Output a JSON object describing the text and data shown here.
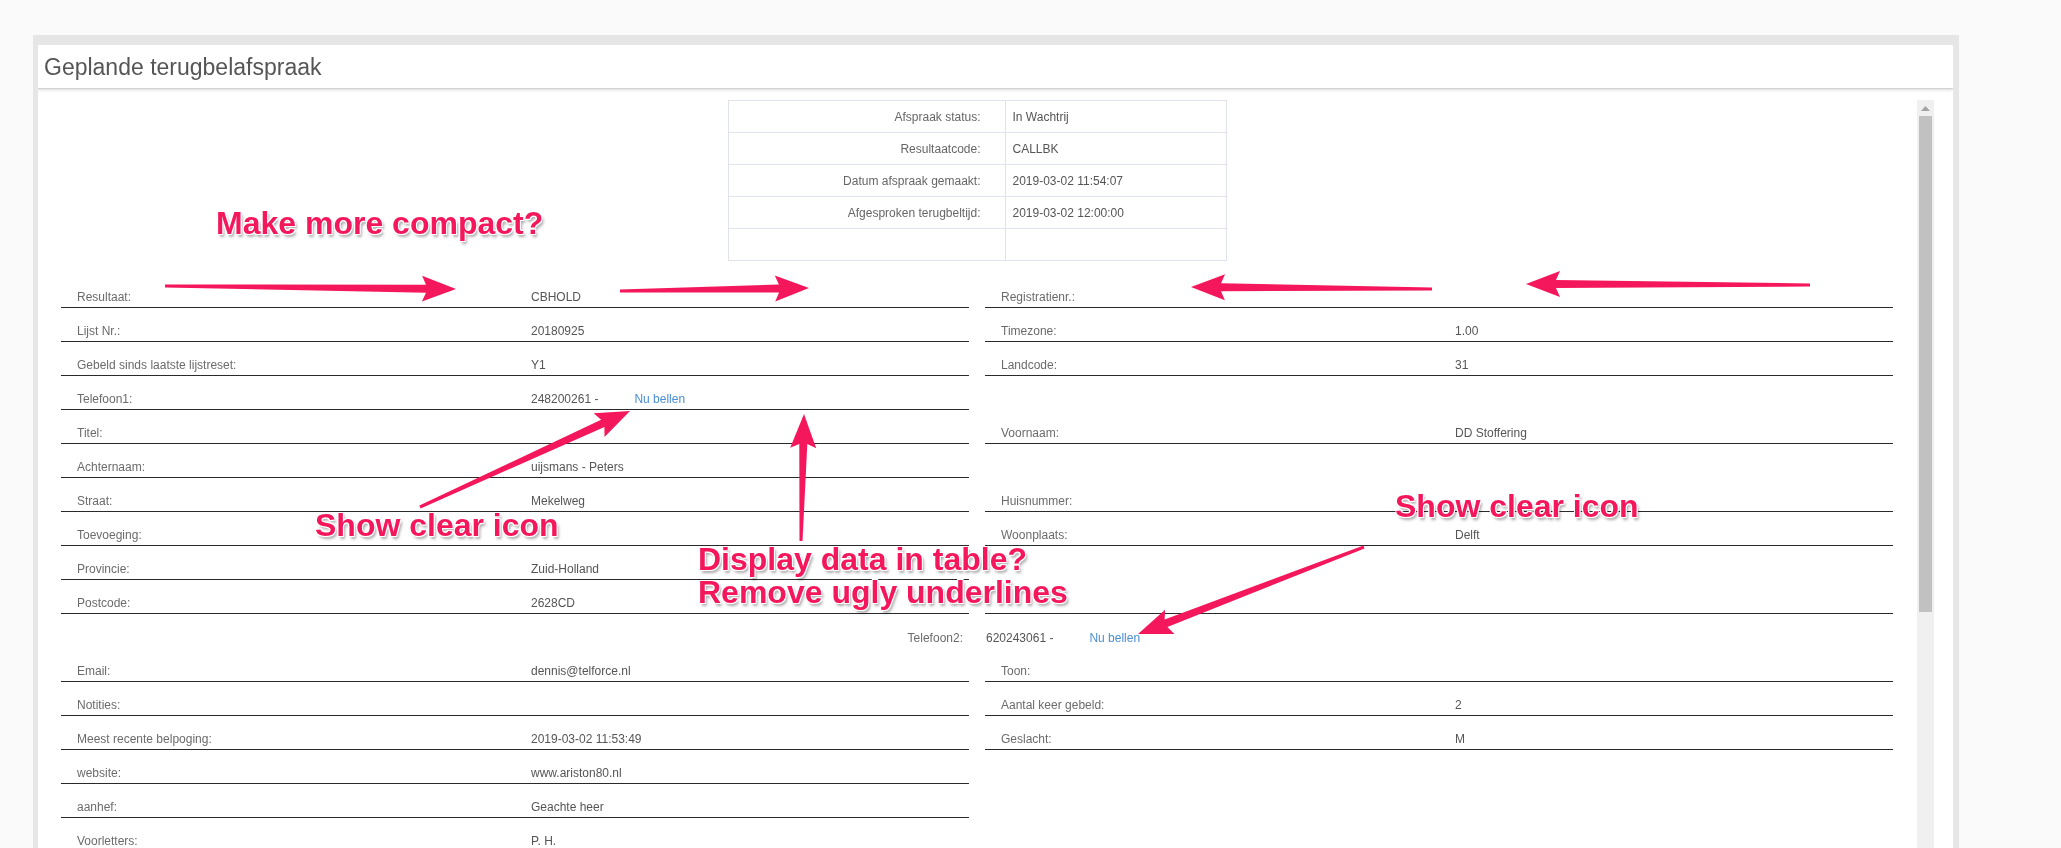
{
  "window": {
    "title": "Geplande terugbelafspraak"
  },
  "status_table": {
    "rows": [
      {
        "kind": "entry",
        "label": "Afspraak status:",
        "value": "In Wachtrij"
      },
      {
        "kind": "entry",
        "label": "Resultaatcode:",
        "value": "CALLBK"
      },
      {
        "kind": "entry",
        "label": "Datum afspraak gemaakt:",
        "value": "2019-03-02 11:54:07"
      },
      {
        "kind": "entry",
        "label": "Afgesproken terugbeltijd:",
        "value": "2019-03-02 12:00:00"
      },
      {
        "kind": "empty"
      }
    ]
  },
  "fields_top": {
    "left": [
      {
        "kind": "field",
        "label": "Resultaat:",
        "value": "CBHOLD"
      },
      {
        "kind": "field",
        "label": "Lijst Nr.:",
        "value": "20180925"
      },
      {
        "kind": "field",
        "label": "Gebeld sinds laatste lijstreset:",
        "value": "Y1"
      },
      {
        "kind": "field",
        "label": "Telefoon1:",
        "value": "248200261 -",
        "link": "Nu bellen"
      },
      {
        "kind": "field",
        "label": "Titel:"
      },
      {
        "kind": "field",
        "label": "Achternaam:",
        "value": "uijsmans - Peters"
      },
      {
        "kind": "field",
        "label": "Straat:",
        "value": "Mekelweg"
      },
      {
        "kind": "field",
        "label": "Toevoeging:"
      },
      {
        "kind": "field",
        "label": "Provincie:",
        "value": "Zuid-Holland"
      },
      {
        "kind": "field",
        "label": "Postcode:",
        "value": "2628CD"
      }
    ],
    "right": [
      {
        "kind": "field",
        "label": "Registratienr.:"
      },
      {
        "kind": "field",
        "label": "Timezone:",
        "value": "1.00"
      },
      {
        "kind": "field",
        "label": "Landcode:",
        "value": "31"
      },
      {
        "kind": "blank"
      },
      {
        "kind": "field",
        "label": "Voornaam:",
        "value": "DD Stoffering"
      },
      {
        "kind": "blank"
      },
      {
        "kind": "field",
        "label": "Huisnummer:"
      },
      {
        "kind": "field",
        "label": "Woonplaats:",
        "value": "Delft"
      },
      {
        "kind": "blank"
      },
      {
        "kind": "rule"
      }
    ]
  },
  "phone_row": {
    "label": "Telefoon2:",
    "value": "620243061 -",
    "link": "Nu bellen"
  },
  "fields_bottom": {
    "left": [
      {
        "kind": "field",
        "label": "Email:",
        "value": "dennis@telforce.nl"
      },
      {
        "kind": "field",
        "label": "Notities:"
      },
      {
        "kind": "field",
        "label": "Meest recente belpoging:",
        "value": "2019-03-02 11:53:49"
      },
      {
        "kind": "field",
        "label": "website:",
        "value": "www.ariston80.nl"
      },
      {
        "kind": "field",
        "label": "aanhef:",
        "value": "Geachte heer"
      },
      {
        "kind": "field",
        "label": "Voorletters:",
        "value": "P. H."
      }
    ],
    "right": [
      {
        "kind": "field",
        "label": "Toon:"
      },
      {
        "kind": "field",
        "label": "Aantal keer gebeld:",
        "value": "2"
      },
      {
        "kind": "field",
        "label": "Geslacht:",
        "value": "M"
      }
    ]
  },
  "annotations": [
    "Make more compact?",
    "Show clear icon",
    "Display data in table?",
    "Remove ugly underlines",
    "Show clear icon"
  ]
}
